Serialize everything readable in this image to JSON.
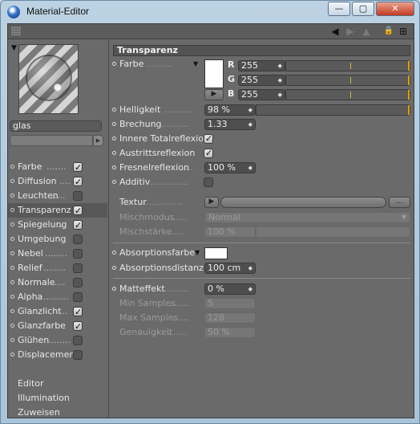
{
  "window": {
    "title": "Material-Editor",
    "close_glyph": "✕",
    "min_glyph": "—",
    "max_glyph": "▢"
  },
  "toolbar": {
    "back_glyph": "◀",
    "forward_glyph": "▶",
    "up_glyph": "▲",
    "lock_glyph": "🔒",
    "new_glyph": "⊞"
  },
  "material": {
    "name": "glas"
  },
  "channels": [
    {
      "label": "Farbe",
      "dots": ".......",
      "checked": true
    },
    {
      "label": "Diffusion",
      "dots": "....",
      "checked": true
    },
    {
      "label": "Leuchten",
      "dots": ".....",
      "checked": false
    },
    {
      "label": "Transparenz",
      "dots": "",
      "checked": true
    },
    {
      "label": "Spiegelung",
      "dots": "..",
      "checked": true
    },
    {
      "label": "Umgebung",
      "dots": "..",
      "checked": false
    },
    {
      "label": "Nebel",
      "dots": "........",
      "checked": false
    },
    {
      "label": "Relief",
      "dots": "........",
      "checked": false
    },
    {
      "label": "Normale",
      "dots": ".....",
      "checked": false
    },
    {
      "label": "Alpha",
      "dots": ".........",
      "checked": false
    },
    {
      "label": "Glanzlicht",
      "dots": "...",
      "checked": true
    },
    {
      "label": "Glanzfarbe",
      "dots": "..",
      "checked": true
    },
    {
      "label": "Glühen",
      "dots": "........",
      "checked": false
    },
    {
      "label": "Displacement",
      "dots": "",
      "checked": false
    }
  ],
  "extra_items": [
    "Editor",
    "Illumination",
    "Zuweisen"
  ],
  "section_title": "Transparenz",
  "farbe": {
    "label": "Farbe",
    "dots": "..........",
    "r_label": "R",
    "g_label": "G",
    "b_label": "B",
    "r": "255",
    "g": "255",
    "b": "255"
  },
  "helligkeit": {
    "label": "Helligkeit",
    "dots": "..........",
    "value": "98 %"
  },
  "brechung": {
    "label": "Brechung",
    "dots": "...........",
    "value": "1.33"
  },
  "innere": {
    "label": "Innere Totalreflexion",
    "checked": true
  },
  "austritt": {
    "label": "Austrittsreflexion",
    "checked": true
  },
  "fresnel": {
    "label": "Fresnelreflexion",
    "dots": "....",
    "value": "100 %"
  },
  "additiv": {
    "label": "Additiv",
    "dots": "...............",
    "checked": false
  },
  "textur": {
    "label": "Textur",
    "dots": "..............",
    "more": "..."
  },
  "mischmodus": {
    "label": "Mischmodus",
    "dots": ".......",
    "value": "Normal"
  },
  "mischstaerke": {
    "label": "Mischstärke",
    "dots": "......",
    "value": "100 %"
  },
  "absorptionsfarbe": {
    "label": "Absorptionsfarbe"
  },
  "absorptionsdistanz": {
    "label": "Absorptionsdistanz",
    "value": "100 cm"
  },
  "matteffekt": {
    "label": "Matteffekt",
    "dots": "..........",
    "value": "0 %"
  },
  "min_samples": {
    "label": "Min Samples",
    "dots": ".......",
    "value": "5"
  },
  "max_samples": {
    "label": "Max Samples",
    "dots": "......",
    "value": "128"
  },
  "genauigkeit": {
    "label": "Genauigkeit",
    "dots": ".......",
    "value": "50 %"
  },
  "colors": {
    "accent": "#e0a000",
    "panel": "#6a6a6a",
    "window_frame": "#bcd2e3"
  }
}
